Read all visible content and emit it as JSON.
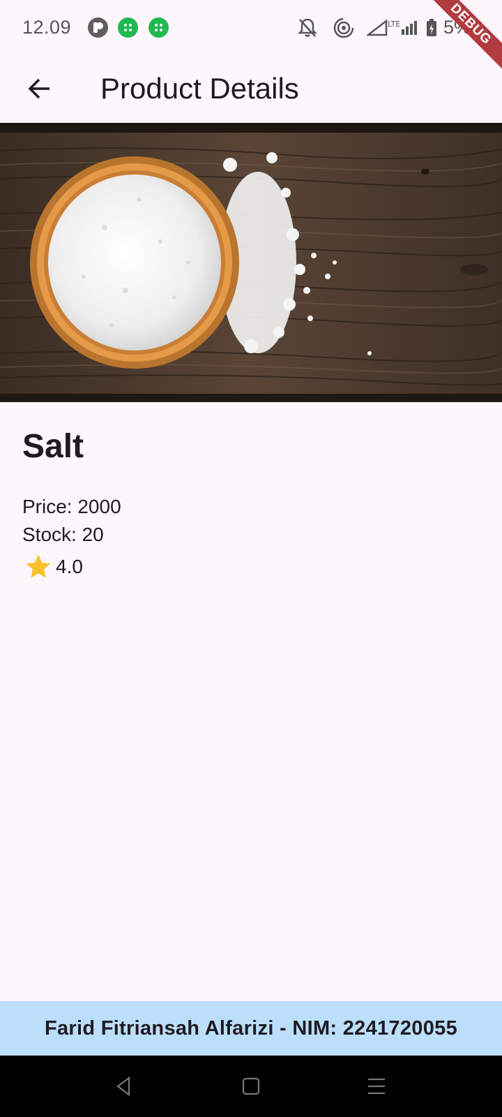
{
  "status_bar": {
    "time": "12.09",
    "battery_text": "5%",
    "icons": [
      "app-icon",
      "app-icon-green",
      "app-icon-green",
      "notifications-off-icon",
      "hotspot-icon",
      "signal-icon",
      "lte-icon",
      "battery-charging-icon"
    ]
  },
  "debug_banner": "DEBUG",
  "app_bar": {
    "title": "Product Details",
    "back_icon": "arrow-back-icon"
  },
  "product": {
    "name": "Salt",
    "price": "Price: 2000",
    "stock": "Stock: 20",
    "rating": "4.0",
    "rating_icon": "star-icon",
    "image": "bowl-of-salt-on-wood-photo"
  },
  "footer": {
    "text": "Farid Fitriansah Alfarizi - NIM: 2241720055"
  },
  "nav_bar": {
    "icons": [
      "back-triangle-icon",
      "home-square-icon",
      "menu-lines-icon"
    ]
  },
  "colors": {
    "background": "#fdf6fd",
    "footer": "#bbdefb",
    "star": "#fbc02d",
    "debug": "#b13c40"
  }
}
